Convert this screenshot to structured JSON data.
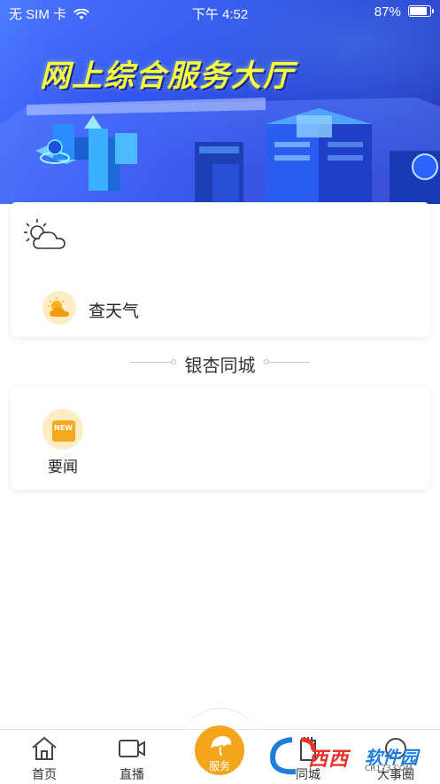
{
  "status_bar": {
    "carrier": "无 SIM 卡",
    "time": "下午 4:52",
    "battery": "87%"
  },
  "banner": {
    "title": "网上综合服务大厅"
  },
  "weather": {
    "icon": "partly-cloudy-icon",
    "item_label": "查天气"
  },
  "section": {
    "title": "银杏同城"
  },
  "news": {
    "badge": "NEW",
    "label": "要闻"
  },
  "tabbar": {
    "tabs": [
      {
        "label": "首页",
        "icon": "home-icon"
      },
      {
        "label": "直播",
        "icon": "video-camera-icon"
      },
      {
        "label": "服务",
        "icon": "ginkgo-leaf-icon"
      },
      {
        "label": "同城",
        "icon": "city-icon"
      },
      {
        "label": "大事圈",
        "icon": "circle-icon"
      }
    ]
  },
  "watermark": {
    "brand_red": "西西",
    "brand_blue": "软件园",
    "url": "CR173.COM"
  },
  "colors": {
    "accent": "#f3a51b",
    "banner_blue": "#2d4ff0",
    "title_yellow": "#f6ff3a"
  }
}
